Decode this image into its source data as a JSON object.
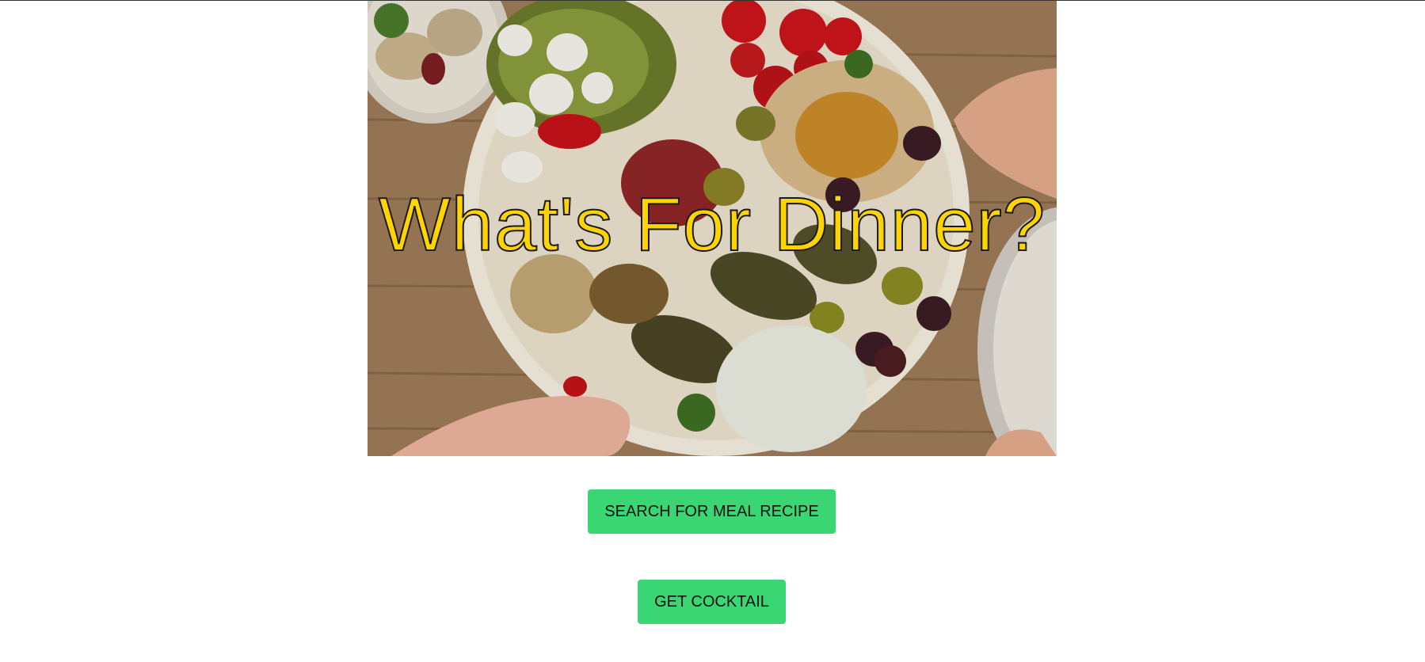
{
  "hero": {
    "title": "What's For Dinner?",
    "image_description_icon": "mezze-platter-image",
    "title_color": "#ffd400"
  },
  "buttons": {
    "meal_label": "SEARCH FOR MEAL RECIPE",
    "cocktail_label": "GET COCKTAIL",
    "color": "#3ad674"
  }
}
